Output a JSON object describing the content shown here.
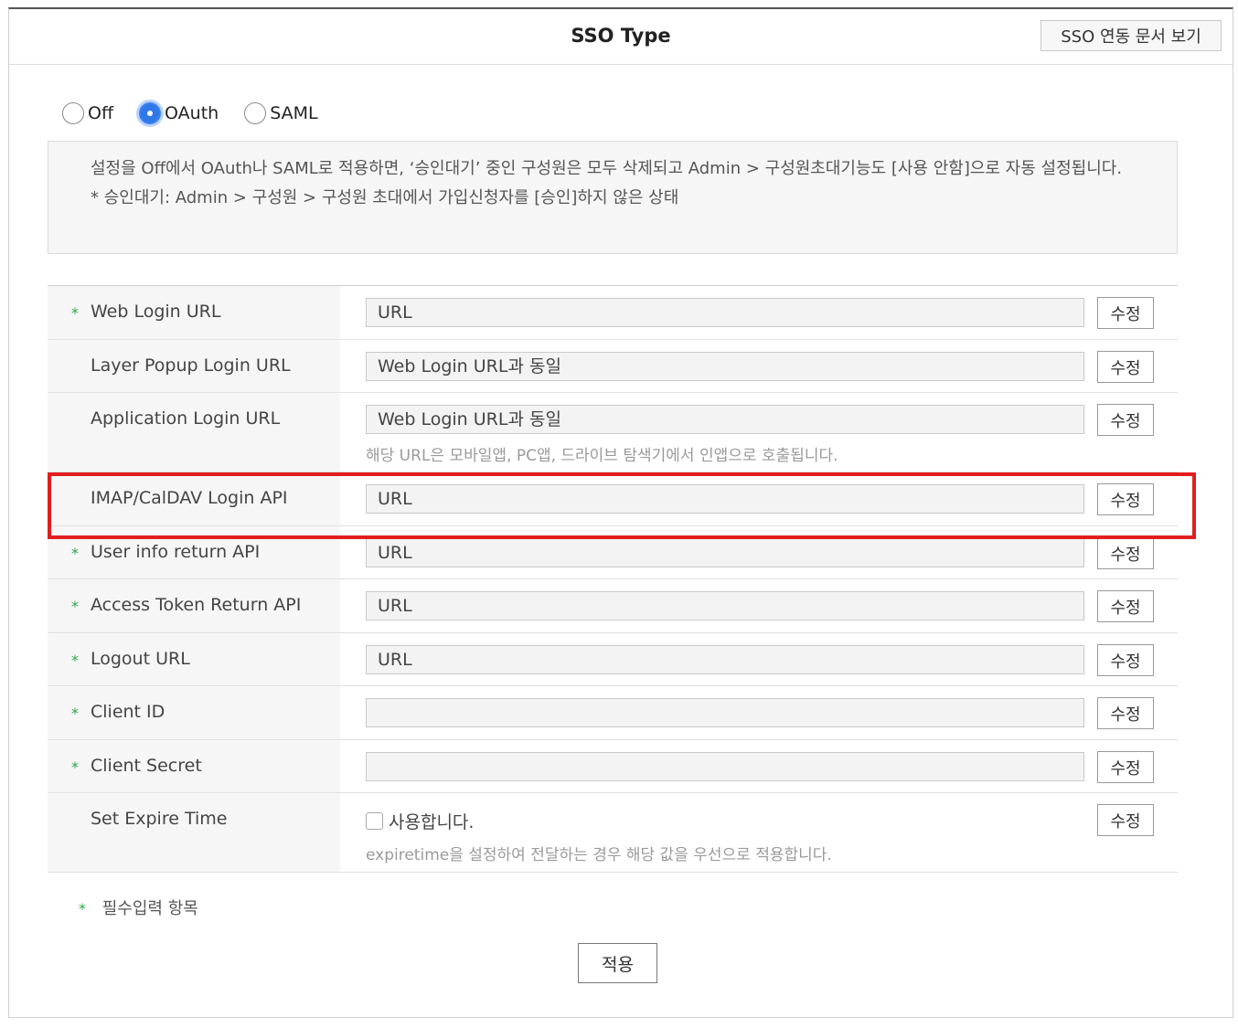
{
  "header": {
    "title": "SSO Type",
    "doc_button": "SSO 연동 문서 보기"
  },
  "sso_type": {
    "options": [
      {
        "label": "Off",
        "checked": false
      },
      {
        "label": "OAuth",
        "checked": true
      },
      {
        "label": "SAML",
        "checked": false
      }
    ]
  },
  "notice": {
    "line1": "설정을 Off에서 OAuth나 SAML로 적용하면, ‘승인대기’ 중인 구성원은 모두 삭제되고 Admin > 구성원초대기능도 [사용 안함]으로 자동 설정됩니다.",
    "line2": "* 승인대기: Admin > 구성원 > 구성원 초대에서 가입신청자를 [승인]하지 않은 상태"
  },
  "form": {
    "edit_label": "수정",
    "rows": [
      {
        "label": "Web Login URL",
        "required": true,
        "value": "URL"
      },
      {
        "label": "Layer Popup Login URL",
        "required": false,
        "value": "Web Login URL과 동일"
      },
      {
        "label": "Application Login URL",
        "required": false,
        "value": "Web Login URL과 동일",
        "hint": "해당 URL은 모바일앱, PC앱, 드라이브 탐색기에서 인앱으로 호출됩니다."
      },
      {
        "label": "IMAP/CalDAV Login API",
        "required": false,
        "value": "URL"
      },
      {
        "label": "User info return API",
        "required": true,
        "value": "URL"
      },
      {
        "label": "Access Token Return API",
        "required": true,
        "value": "URL"
      },
      {
        "label": "Logout URL",
        "required": true,
        "value": "URL"
      },
      {
        "label": "Client ID",
        "required": true,
        "value": ""
      },
      {
        "label": "Client Secret",
        "required": true,
        "value": ""
      },
      {
        "label": "Set Expire Time",
        "required": false,
        "checkbox_label": "사용합니다.",
        "checkbox_checked": false,
        "hint": "expiretime을 설정하여 전달하는 경우 해당 값을 우선으로 적용합니다."
      }
    ],
    "required_mark": "*",
    "required_note": "필수입력 항목"
  },
  "apply_button": "적용",
  "colors": {
    "highlight": "#e01e1e",
    "radio_selected": "#2f78e8",
    "required_mark": "#2aa84a"
  }
}
